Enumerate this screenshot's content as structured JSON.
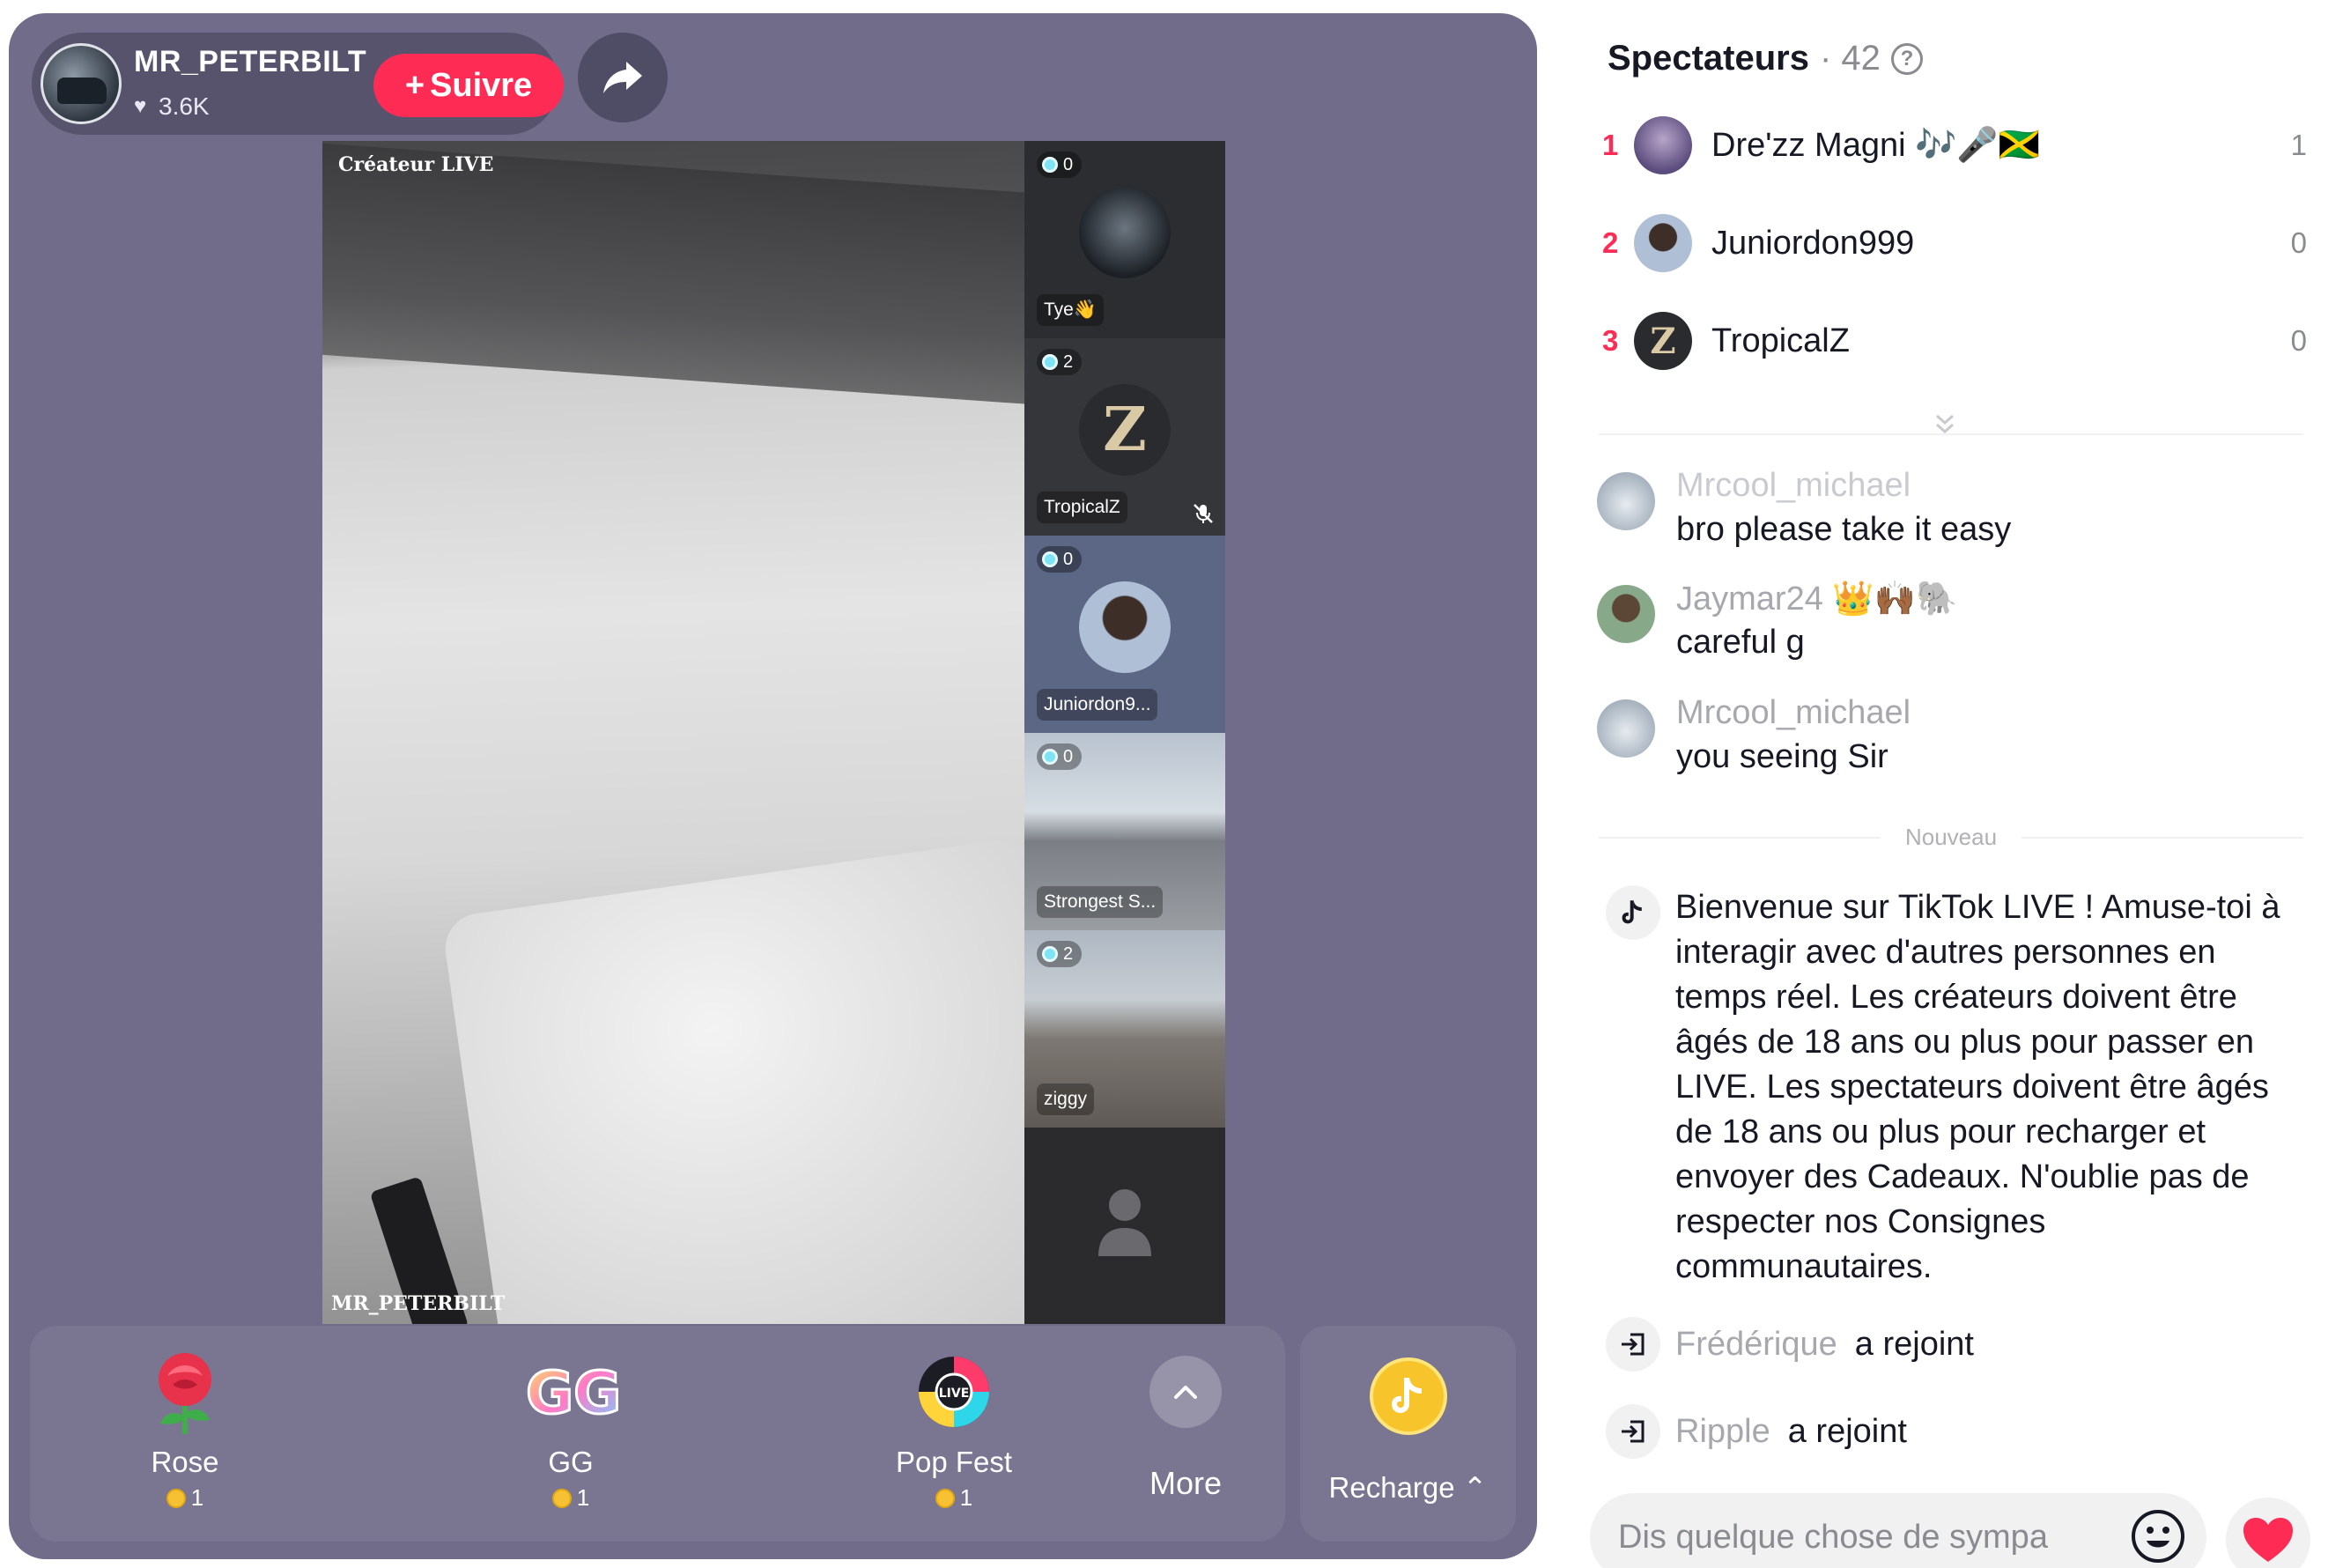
{
  "host": {
    "name": "MR_PETERBILT",
    "likes": "3.6K",
    "follow_label": "Suivre"
  },
  "stage": {
    "creator_label": "Créateur LIVE",
    "host_tag": "MR_PETERBILT"
  },
  "guests": [
    {
      "name": "Tye👋",
      "count": "0"
    },
    {
      "name": "TropicalZ",
      "count": "2",
      "muted": true
    },
    {
      "name": "Juniordon9...",
      "count": "0"
    },
    {
      "name": "Strongest S...",
      "count": "0"
    },
    {
      "name": "ziggy",
      "count": "2"
    },
    {
      "name": "",
      "count": ""
    }
  ],
  "gifts": [
    {
      "name": "Rose",
      "price": "1",
      "icon": "rose-icon"
    },
    {
      "name": "GG",
      "price": "1",
      "icon": "gg-icon"
    },
    {
      "name": "Pop Fest",
      "price": "1",
      "icon": "popfest-icon"
    }
  ],
  "more_label": "More",
  "recharge_label": "Recharge",
  "viewers": {
    "title": "Spectateurs",
    "count": "42",
    "list": [
      {
        "rank": "1",
        "name": "Dre'zz Magni 🎶🎤🇯🇲",
        "score": "1"
      },
      {
        "rank": "2",
        "name": "Juniordon999",
        "score": "0"
      },
      {
        "rank": "3",
        "name": "TropicalZ",
        "score": "0"
      }
    ]
  },
  "chat": [
    {
      "user": "Mrcool_michael",
      "text": "bro please take it easy"
    },
    {
      "user": "Jaymar24 👑🙌🏾🐘",
      "text": "careful g"
    },
    {
      "user": "Mrcool_michael",
      "text": "you seeing Sir"
    }
  ],
  "nouveau_label": "Nouveau",
  "welcome_text": "Bienvenue sur TikTok LIVE ! Amuse-toi à interagir avec d'autres personnes en temps réel. Les créateurs doivent être âgés de 18 ans ou plus pour passer en LIVE. Les spectateurs doivent être âgés de 18 ans ou plus pour recharger et envoyer des Cadeaux. N'oublie pas de respecter nos Consignes communautaires.",
  "joins": [
    {
      "name": "Frédérique",
      "text": "a rejoint"
    },
    {
      "name": "Ripple",
      "text": "a rejoint"
    }
  ],
  "comment": {
    "placeholder": "Dis quelque chose de sympa"
  },
  "colors": {
    "accent": "#fe2c55",
    "panel": "#706c89",
    "coin": "#f6c233"
  }
}
